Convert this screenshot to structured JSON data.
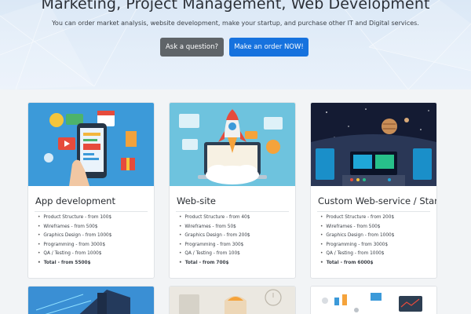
{
  "hero": {
    "title": "Marketing, Project Management, Web Development",
    "subtitle": "You can order market analysis, website development, make your startup, and purchase other IT and Digital services.",
    "ask_button": "Ask a question?",
    "order_button": "Make an order NOW!"
  },
  "cards": [
    {
      "title": "App development",
      "items": [
        "Product Structure - from 100$",
        "Wireframes - from 500$",
        "Graphics Design - from 1000$",
        "Programming - from 3000$",
        "QA / Testing - from 1000$"
      ],
      "total": "Total - from 5500$",
      "image_icon": "mobile-app-illustration"
    },
    {
      "title": "Web-site",
      "items": [
        "Product Structure - from 40$",
        "Wireframes - from 50$",
        "Graphics Design - from 200$",
        "Programming - from 300$",
        "QA / Testing - from 100$"
      ],
      "total": "Total - from 700$",
      "image_icon": "rocket-laptop-illustration"
    },
    {
      "title": "Custom Web-service / Startup",
      "items": [
        "Product Structure - from 200$",
        "Wireframes - from 500$",
        "Graphics Design - from 1000$",
        "Programming - from 3000$",
        "QA / Testing - from 1000$"
      ],
      "total": "Total - from 6000$",
      "image_icon": "spaceship-cockpit-illustration"
    }
  ],
  "colors": {
    "primary": "#1672de",
    "secondary": "#5f6468",
    "hero_bg": "#dde9f6",
    "app_bg": "#3c9ad9",
    "web_bg": "#6ec3de",
    "space_bg": "#141b33"
  }
}
